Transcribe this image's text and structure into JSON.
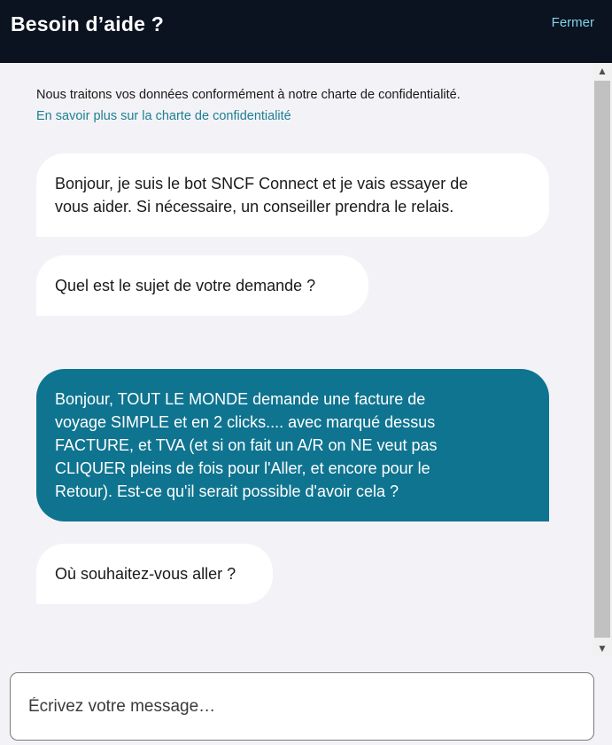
{
  "header": {
    "title": "Besoin d’aide ?",
    "close_label": "Fermer"
  },
  "privacy": {
    "notice": "Nous traitons vos données conformément à notre charte de confidentialité.",
    "link_label": "En savoir plus sur la charte de confidentialité"
  },
  "messages": [
    {
      "sender": "bot",
      "lines": [
        "Bonjour, je suis le bot SNCF Connect et je vais essayer de",
        "vous aider. Si nécessaire, un conseiller prendra le relais."
      ]
    },
    {
      "sender": "bot",
      "lines": [
        "Quel est le sujet de votre demande ?"
      ]
    },
    {
      "sender": "user",
      "lines": [
        "Bonjour, TOUT LE MONDE demande une facture de",
        "voyage SIMPLE et en 2 clicks.... avec marqué dessus",
        "FACTURE, et TVA (et si on fait un A/R on NE veut pas",
        "CLIQUER pleins de fois pour l'Aller, et encore pour le",
        "Retour). Est-ce qu'il serait possible d'avoir cela ?"
      ]
    },
    {
      "sender": "bot",
      "lines": [
        "Où souhaitez-vous aller ?"
      ]
    }
  ],
  "composer": {
    "placeholder": "Écrivez votre message…"
  },
  "scrollbar": {
    "up_icon": "▲",
    "down_icon": "▼"
  },
  "colors": {
    "header_bg": "#0b1220",
    "close_link": "#7fd4e8",
    "privacy_link": "#1d7f91",
    "user_bubble": "#0f7490",
    "bot_bubble": "#ffffff",
    "chat_bg": "#f3f3f7"
  }
}
